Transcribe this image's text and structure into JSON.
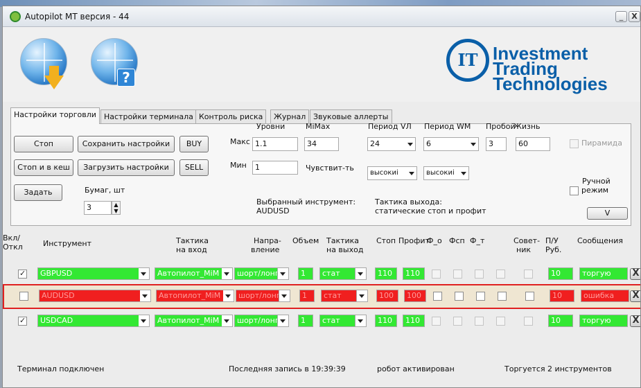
{
  "window": {
    "title": "Autopilot MT  версия - 44",
    "minimize_glyph": "_",
    "close_glyph": "X"
  },
  "logo": {
    "mark": "IT",
    "line1": "Investment",
    "line2": "Trading",
    "line3": "Technologies",
    "color": "#0a5fa8"
  },
  "icons": {
    "download": "globe-download-icon",
    "help": "globe-help-icon",
    "help_glyph": "?"
  },
  "tabs": [
    {
      "label": "Настройки торговли",
      "active": true
    },
    {
      "label": "Настройки терминала"
    },
    {
      "label": "Контроль риска"
    },
    {
      "label": "Журнал"
    },
    {
      "label": "Звуковые аллерты"
    }
  ],
  "settings": {
    "stop": "Стоп",
    "save": "Сохранить настройки",
    "buy": "BUY",
    "stop_cash": "Стоп и в кеш",
    "load": "Загрузить настройки",
    "sell": "SELL",
    "set": "Задать",
    "papers_label": "Бумаг, шт",
    "papers_value": "3",
    "levels_label": "Уровни",
    "mimax_label": "MiMax",
    "max_label": "Макс",
    "max_value": "1.1",
    "mimax_value": "34",
    "min_label": "Мин",
    "min_value": "1",
    "sensitivity_label": "Чувствит-ть",
    "period_vl_label": "Период VЛ",
    "period_vl_value": "24",
    "period_vl_mode": "высокиі",
    "period_wm_label": "Период WM",
    "period_wm_value": "6",
    "period_wm_mode": "высокиі",
    "breakout_label": "Пробой",
    "breakout_value": "3",
    "life_label": "Жизнь",
    "life_value": "60",
    "pyramid_label": "Пирамида",
    "manual_line1": "Ручной",
    "manual_line2": "режим",
    "v_button": "V",
    "selected_label": "Выбранный инструмент:",
    "selected_value": "AUDUSD",
    "exit_tactic_label": "Тактика выхода:",
    "exit_tactic_value": "статические стоп и профит"
  },
  "columns": {
    "on_off1": "Вкл/",
    "on_off2": "Откл",
    "instrument": "Инструмент",
    "entry1": "Тактика",
    "entry2": "на вход",
    "dir1": "Напра-",
    "dir2": "вление",
    "volume": "Объем",
    "exit1": "Тактика",
    "exit2": "на выход",
    "stop": "Стоп",
    "profit": "Профит",
    "f_o": "Ф_о",
    "f_sp": "Фсп",
    "f_t": "Ф_т",
    "advisor1": "Совет-",
    "advisor2": "ник",
    "pnl1": "П/У",
    "pnl2": "Руб.",
    "messages": "Сообщения"
  },
  "rows": [
    {
      "enabled": true,
      "instrument": "GBPUSD",
      "entry": "Автопилот_MiM",
      "direction": "шорт/лонг",
      "volume": "1",
      "exit": "стат",
      "stop": "110",
      "profit": "110",
      "pnl": "10",
      "message": "торгую",
      "status": "ok"
    },
    {
      "enabled": false,
      "instrument": "AUDUSD",
      "entry": "Автопилот_MiM",
      "direction": "шорт/лонг",
      "volume": "1",
      "exit": "стат",
      "stop": "100",
      "profit": "100",
      "pnl": "10",
      "message": "ошибка",
      "status": "error"
    },
    {
      "enabled": true,
      "instrument": "USDCAD",
      "entry": "Автопилот_MiM",
      "direction": "шорт/лонг",
      "volume": "1",
      "exit": "стат",
      "stop": "110",
      "profit": "110",
      "pnl": "10",
      "message": "торгую",
      "status": "ok"
    }
  ],
  "row_close_glyph": "X",
  "status": {
    "connection": "Терминал подключен",
    "last_record": "Последняя запись в 19:39:39",
    "robot": "робот активирован",
    "trading": "Торгуется 2 инструментов"
  },
  "colors": {
    "ok": "#33e833",
    "error": "#f01f1f",
    "selected_row_border": "#e02020"
  }
}
